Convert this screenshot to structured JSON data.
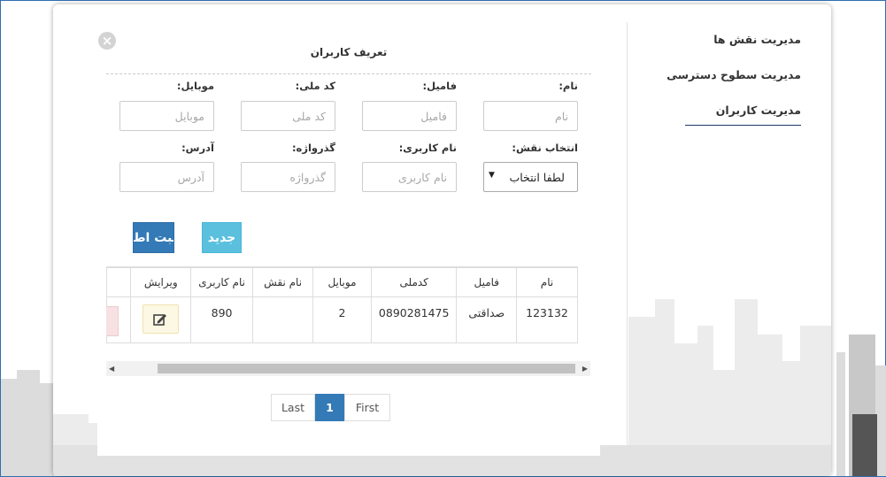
{
  "sidebar": {
    "items": [
      {
        "label": "مدیریت نقش ها"
      },
      {
        "label": "مدیریت سطوح دسترسی"
      },
      {
        "label": "مدیریت کاربران"
      }
    ]
  },
  "dialog": {
    "title": "تعریف کاربران",
    "close_glyph": "×",
    "fields": {
      "first_name": {
        "label": "نام:",
        "placeholder": "نام"
      },
      "last_name": {
        "label": "فامیل:",
        "placeholder": "فامیل"
      },
      "national_code": {
        "label": "کد ملی:",
        "placeholder": "کد ملی"
      },
      "mobile": {
        "label": "موبایل:",
        "placeholder": "موبایل"
      },
      "role": {
        "label": "انتخاب نقش:",
        "value": "لطفا انتخاب"
      },
      "username": {
        "label": "نام کاربری:",
        "placeholder": "نام کاربری"
      },
      "password": {
        "label": "گذرواژه:",
        "placeholder": "گذرواژه"
      },
      "address": {
        "label": "آدرس:",
        "placeholder": "آدرس"
      }
    },
    "buttons": {
      "new_label": "جدید",
      "save_label": "ثبت اطلاعات"
    }
  },
  "table": {
    "headers": [
      "نام",
      "فامیل",
      "کدملی",
      "موبایل",
      "نام نقش",
      "نام کاربری",
      "ویرایش"
    ],
    "rows": [
      {
        "name": "123132",
        "family": "صداقتی",
        "national_code": "0890281475",
        "mobile": "2",
        "role": "",
        "username": "890"
      }
    ]
  },
  "pager": {
    "last": "Last",
    "current": "1",
    "first": "First"
  },
  "colors": {
    "primary": "#337ab7",
    "info": "#5bc0de",
    "warning_bg": "#fcf8e3",
    "danger_bg": "#f7e1e3"
  }
}
